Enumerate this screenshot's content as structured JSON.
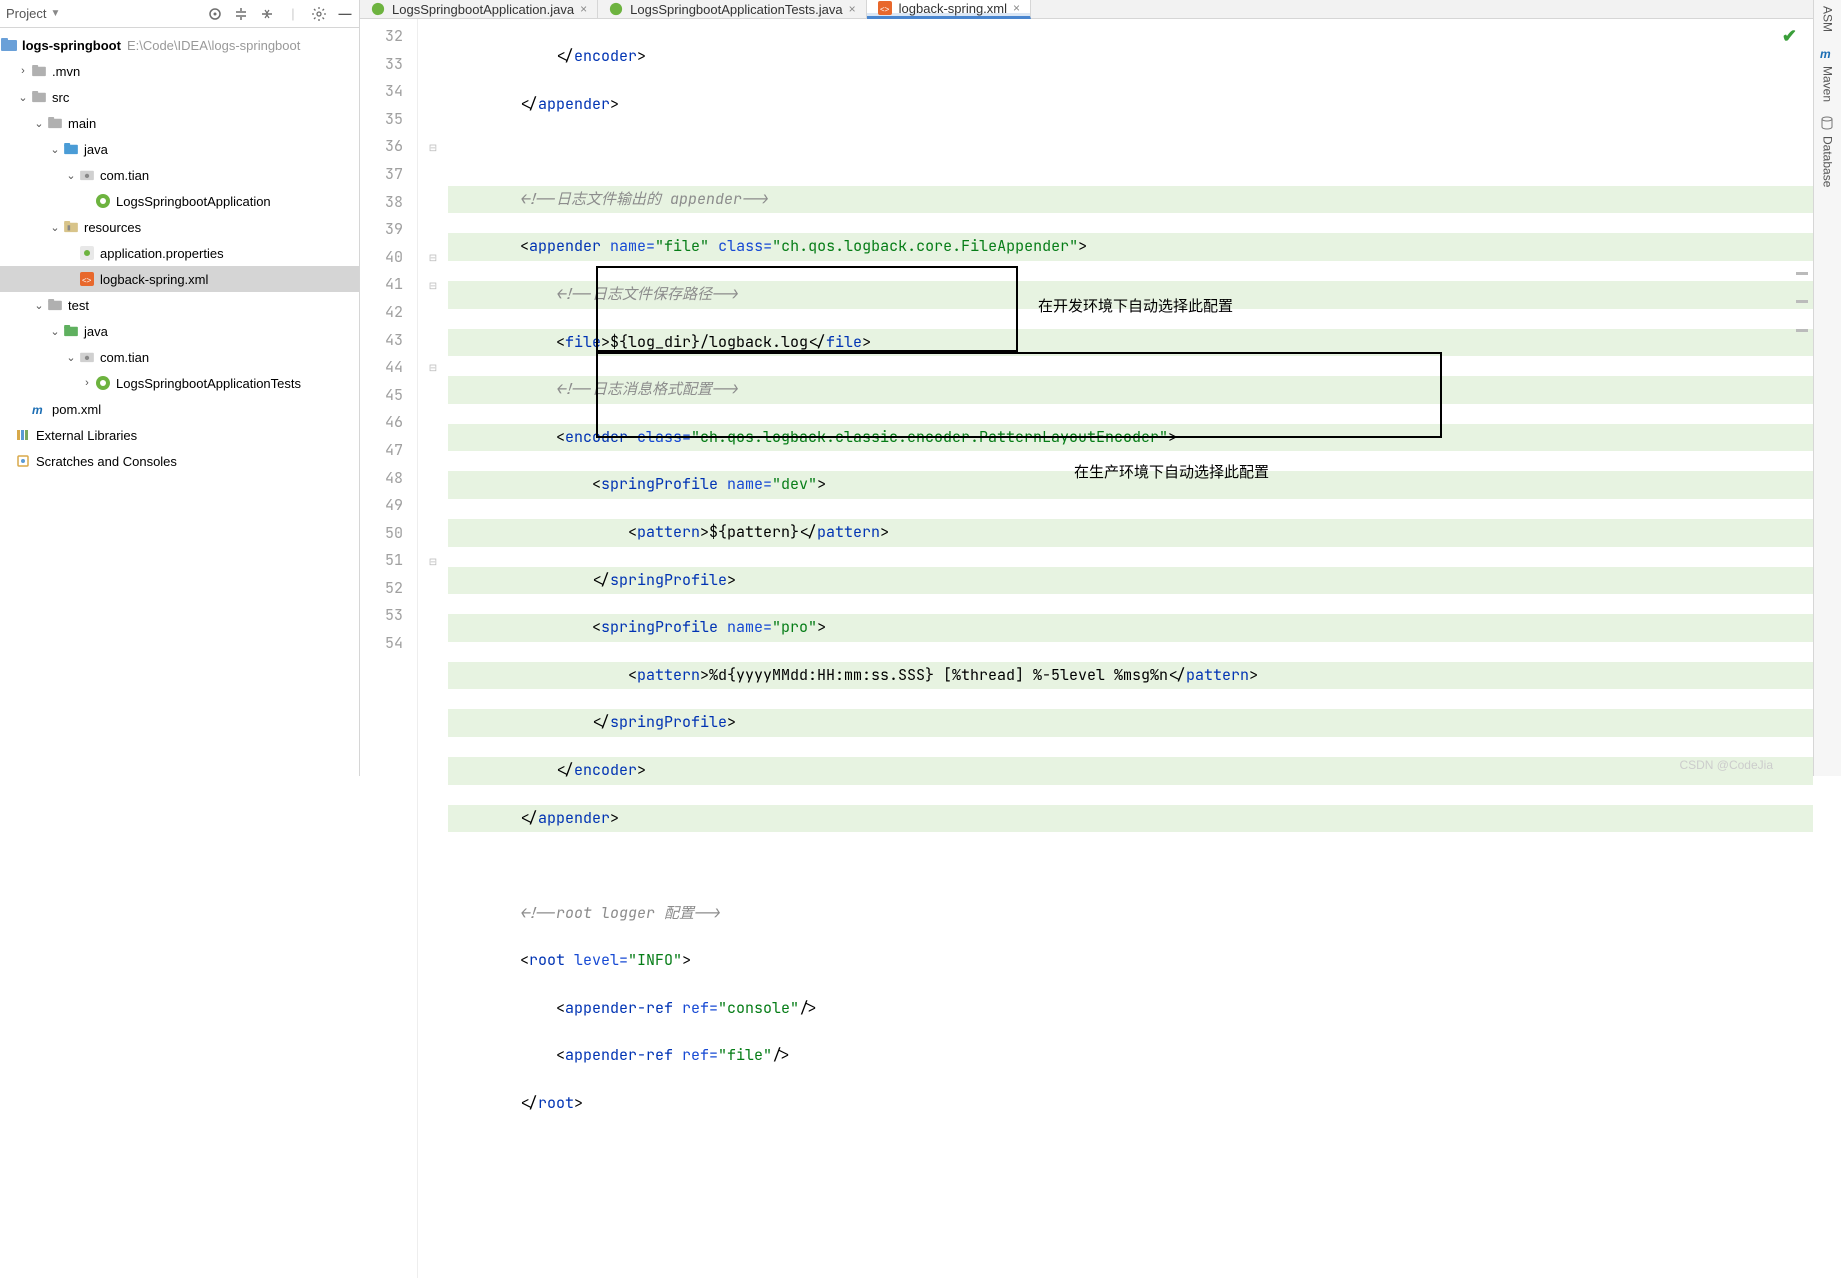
{
  "toolbar": {
    "title": "Project"
  },
  "tree": {
    "root": {
      "label": "logs-springboot",
      "path": "E:\\Code\\IDEA\\logs-springboot"
    },
    "mvn": ".mvn",
    "src": "src",
    "main": "main",
    "java": "java",
    "pkg_main": "com.tian",
    "app_main": "LogsSpringbootApplication",
    "resources": "resources",
    "app_props": "application.properties",
    "logback": "logback-spring.xml",
    "test": "test",
    "java2": "java",
    "pkg_test": "com.tian",
    "app_test": "LogsSpringbootApplicationTests",
    "pom": "pom.xml",
    "ext_lib": "External Libraries",
    "scratches": "Scratches and Consoles"
  },
  "tabs": {
    "t1": "LogsSpringbootApplication.java",
    "t2": "LogsSpringbootApplicationTests.java",
    "t3": "logback-spring.xml"
  },
  "gutter": [
    "32",
    "33",
    "34",
    "35",
    "36",
    "37",
    "38",
    "39",
    "40",
    "41",
    "42",
    "43",
    "44",
    "45",
    "46",
    "47",
    "48",
    "49",
    "50",
    "51",
    "52",
    "53",
    "54"
  ],
  "annotations": {
    "dev": "在开发环境下自动选择此配置",
    "pro": "在生产环境下自动选择此配置"
  },
  "code": {
    "l32": {
      "pre": "            </",
      "tag": "encoder",
      "post": ">"
    },
    "l33": {
      "pre": "        </",
      "tag": "appender",
      "post": ">"
    },
    "l34": "",
    "l35": {
      "pre": "        ",
      "cmt": "<!--日志文件输出的 appender-->"
    },
    "l36": {
      "pre": "        <",
      "tag": "appender",
      "a1": " name=",
      "v1": "\"file\"",
      "a2": " class=",
      "v2": "\"ch.qos.logback.core.FileAppender\"",
      "post": ">"
    },
    "l37": {
      "pre": "            ",
      "cmt": "<!--日志文件保存路径-->"
    },
    "l38": {
      "pre": "            <",
      "tag1": "file",
      "mid": ">${log_dir}/logback.log</",
      "tag2": "file",
      "post": ">"
    },
    "l39": {
      "pre": "            ",
      "cmt": "<!--日志消息格式配置-->"
    },
    "l40": {
      "pre": "            <",
      "tag": "encoder",
      "a1": " class=",
      "v1": "\"ch.qos.logback.classic.encoder.PatternLayoutEncoder\"",
      "post": ">"
    },
    "l41": {
      "pre": "                <",
      "tag": "springProfile",
      "a1": " name=",
      "v1": "\"dev\"",
      "post": ">"
    },
    "l42": {
      "pre": "                    <",
      "tag1": "pattern",
      "mid": ">${pattern}</",
      "tag2": "pattern",
      "post": ">"
    },
    "l43": {
      "pre": "                </",
      "tag": "springProfile",
      "post": ">"
    },
    "l44": {
      "pre": "                <",
      "tag": "springProfile",
      "a1": " name=",
      "v1": "\"pro\"",
      "post": ">"
    },
    "l45": {
      "pre": "                    <",
      "tag1": "pattern",
      "mid": ">%d{yyyyMMdd:HH:mm:ss.SSS} [%thread] %-5level %msg%n</",
      "tag2": "pattern",
      "post": ">"
    },
    "l46": {
      "pre": "                </",
      "tag": "springProfile",
      "post": ">"
    },
    "l47": {
      "pre": "            </",
      "tag": "encoder",
      "post": ">"
    },
    "l48": {
      "pre": "        </",
      "tag": "appender",
      "post": ">"
    },
    "l49": "",
    "l50": {
      "pre": "        ",
      "cmt": "<!--root logger 配置-->"
    },
    "l51": {
      "pre": "        <",
      "tag": "root",
      "a1": " level=",
      "v1": "\"INFO\"",
      "post": ">"
    },
    "l52": {
      "pre": "            <",
      "tag": "appender-ref",
      "a1": " ref=",
      "v1": "\"console\"",
      "post": "/>"
    },
    "l53": {
      "pre": "            <",
      "tag": "appender-ref",
      "a1": " ref=",
      "v1": "\"file\"",
      "post": "/>"
    },
    "l54": {
      "pre": "        </",
      "tag": "root",
      "post": ">"
    }
  },
  "rightbar": {
    "asm": "ASM",
    "maven": "Maven",
    "database": "Database"
  },
  "watermark": "CSDN @CodeJia"
}
